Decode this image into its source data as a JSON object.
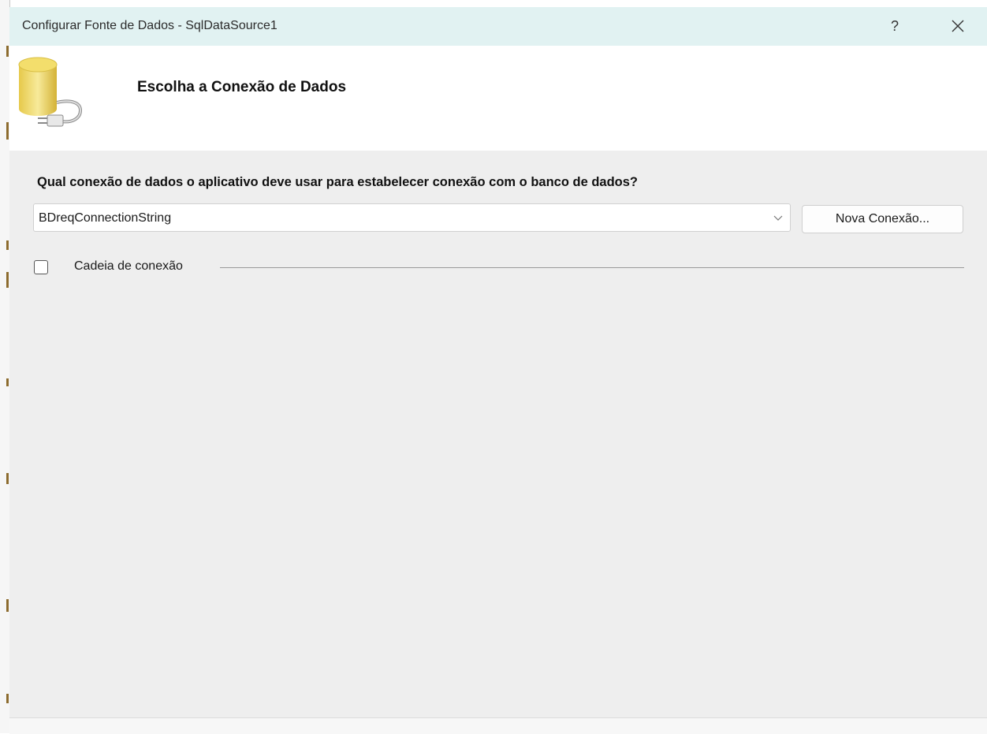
{
  "dialog": {
    "title": "Configurar Fonte de Dados - SqlDataSource1",
    "help_label": "?",
    "close_icon": "close-icon"
  },
  "header": {
    "title": "Escolha a Conexão de Dados",
    "icon": "database-connection-icon"
  },
  "body": {
    "question": "Qual conexão de dados o aplicativo deve usar para estabelecer conexão com o banco de dados?",
    "connection_select": {
      "selected": "BDreqConnectionString",
      "chevron_icon": "chevron-down-icon"
    },
    "new_connection_label": "Nova Conexão...",
    "connection_string_toggle": {
      "label": "Cadeia de conexão",
      "checked": false
    }
  },
  "colors": {
    "titlebar": "#e1f2f2",
    "body_bg": "#eeeeee",
    "header_bg": "#ffffff"
  }
}
